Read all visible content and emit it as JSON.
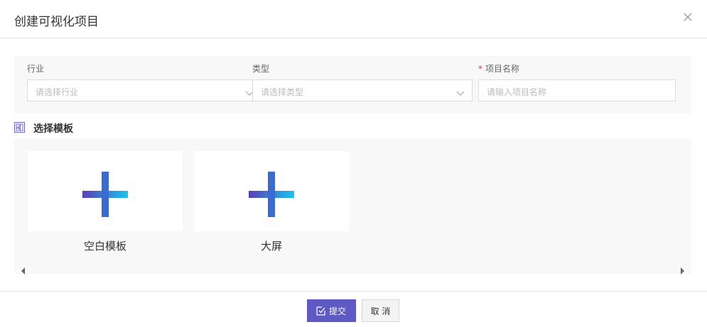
{
  "dialog": {
    "title": "创建可视化项目"
  },
  "form": {
    "industry": {
      "label": "行业",
      "placeholder": "请选择行业"
    },
    "type": {
      "label": "类型",
      "placeholder": "请选择类型"
    },
    "project_name": {
      "required_mark": "*",
      "label": "项目名称",
      "placeholder": "请输入项目名称"
    }
  },
  "templates": {
    "section_title": "选择模板",
    "items": [
      {
        "label": "空白模板"
      },
      {
        "label": "大屏"
      }
    ]
  },
  "footer": {
    "submit_label": "提交",
    "cancel_label": "取 消"
  },
  "colors": {
    "accent": "#5f59c4",
    "plus_gradient_start": "#5b3fb5",
    "plus_gradient_end": "#19c3f0"
  }
}
